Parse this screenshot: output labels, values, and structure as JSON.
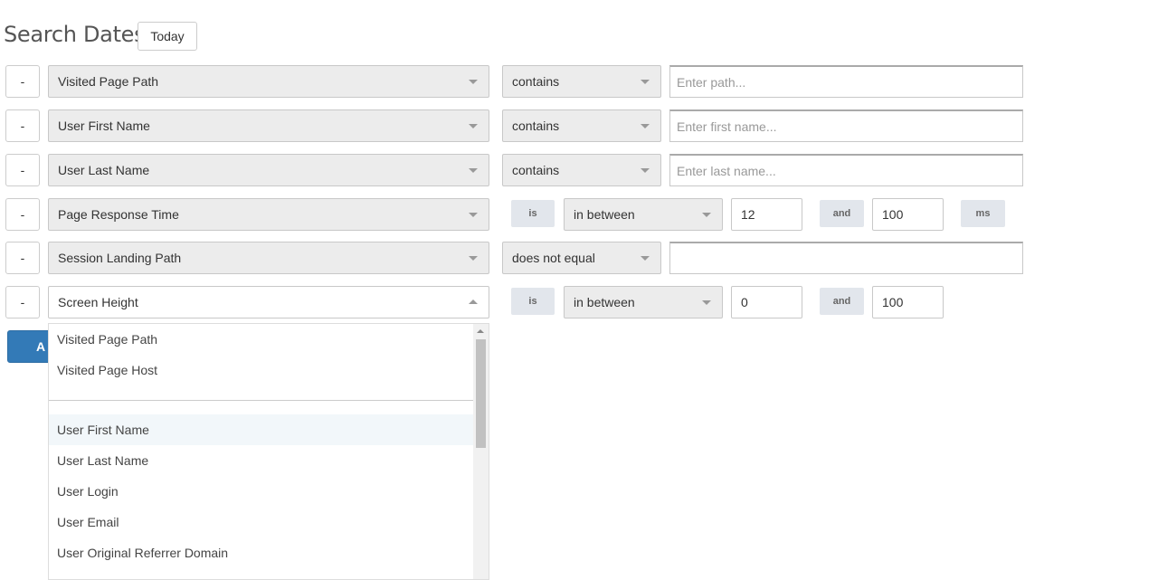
{
  "header": {
    "title": "Search Dates:",
    "today_label": "Today"
  },
  "remove_label": "-",
  "rows": [
    {
      "field": "Visited Page Path",
      "operator": "contains",
      "placeholder": "Enter path..."
    },
    {
      "field": "User First Name",
      "operator": "contains",
      "placeholder": "Enter first name..."
    },
    {
      "field": "User Last Name",
      "operator": "contains",
      "placeholder": "Enter last name..."
    },
    {
      "field": "Page Response Time",
      "is_label": "is",
      "operator": "in between",
      "min": "12",
      "and_label": "and",
      "max": "100",
      "unit": "ms"
    },
    {
      "field": "Session Landing Path",
      "operator": "does not equal",
      "value": ""
    },
    {
      "field": "Screen Height",
      "is_label": "is",
      "operator": "in between",
      "min": "0",
      "and_label": "and",
      "max": "100"
    }
  ],
  "add_button_label": "A",
  "dropdown": {
    "items": [
      "Visited Page Path",
      "Visited Page Host",
      "User First Name",
      "User Last Name",
      "User Login",
      "User Email",
      "User Original Referrer Domain"
    ],
    "highlighted": "User First Name",
    "scroll_position": 0.0
  },
  "colors": {
    "primary": "#337ab7",
    "select_bg": "#ececec",
    "tag_bg": "#e2e6ec",
    "highlight": "#f2f7fa"
  }
}
